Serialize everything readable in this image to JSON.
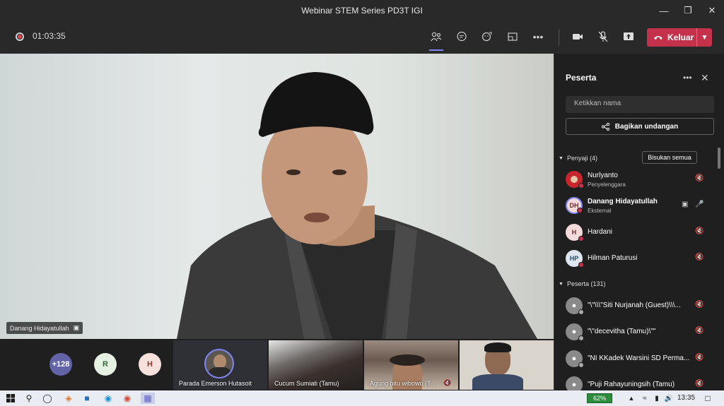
{
  "window": {
    "title": "Webinar STEM Series PD3T IGI"
  },
  "toolbar": {
    "timer": "01:03:35",
    "leave_label": "Keluar"
  },
  "stage": {
    "speaker_name": "Danang Hidayatullah"
  },
  "strip": {
    "overflow_count": "+128",
    "bubbles": [
      "R",
      "H"
    ],
    "tiles": [
      {
        "name": "Parada Emerson Hutasoit"
      },
      {
        "name": "Cucum Sumiati (Tamu)"
      },
      {
        "name": "Agung bitu wibowo (T..."
      },
      {
        "name": ""
      }
    ]
  },
  "panel": {
    "title": "Peserta",
    "search_placeholder": "Ketikkan nama",
    "invite_label": "Bagikan undangan",
    "presenters_header": "Penyaji (4)",
    "mute_all_label": "Bisukan semua",
    "presenters": [
      {
        "initials": "",
        "name": "Nurlyanto",
        "role": "Penyelenggara"
      },
      {
        "initials": "DH",
        "name": "Danang Hidayatullah",
        "role": "Eksternal"
      },
      {
        "initials": "H",
        "name": "Hardani",
        "role": ""
      },
      {
        "initials": "HP",
        "name": "Hilman Paturusi",
        "role": ""
      }
    ],
    "attendees_header": "Peserta (131)",
    "attendees": [
      {
        "name": "\"\\\"\\\\\\\"Siti Nurjanah (Guest)\\\\\\..."
      },
      {
        "name": "\"\\\"decevitha (Tamu)\\\"\""
      },
      {
        "name": "\"NI KKadek Warsini SD Perma..."
      },
      {
        "name": "\"Puji Rahayuningsih (Tamu)"
      }
    ]
  },
  "taskbar": {
    "battery": "62%",
    "time": "13:35"
  },
  "colors": {
    "leave": "#c4314b",
    "accent": "#7f85f5"
  }
}
